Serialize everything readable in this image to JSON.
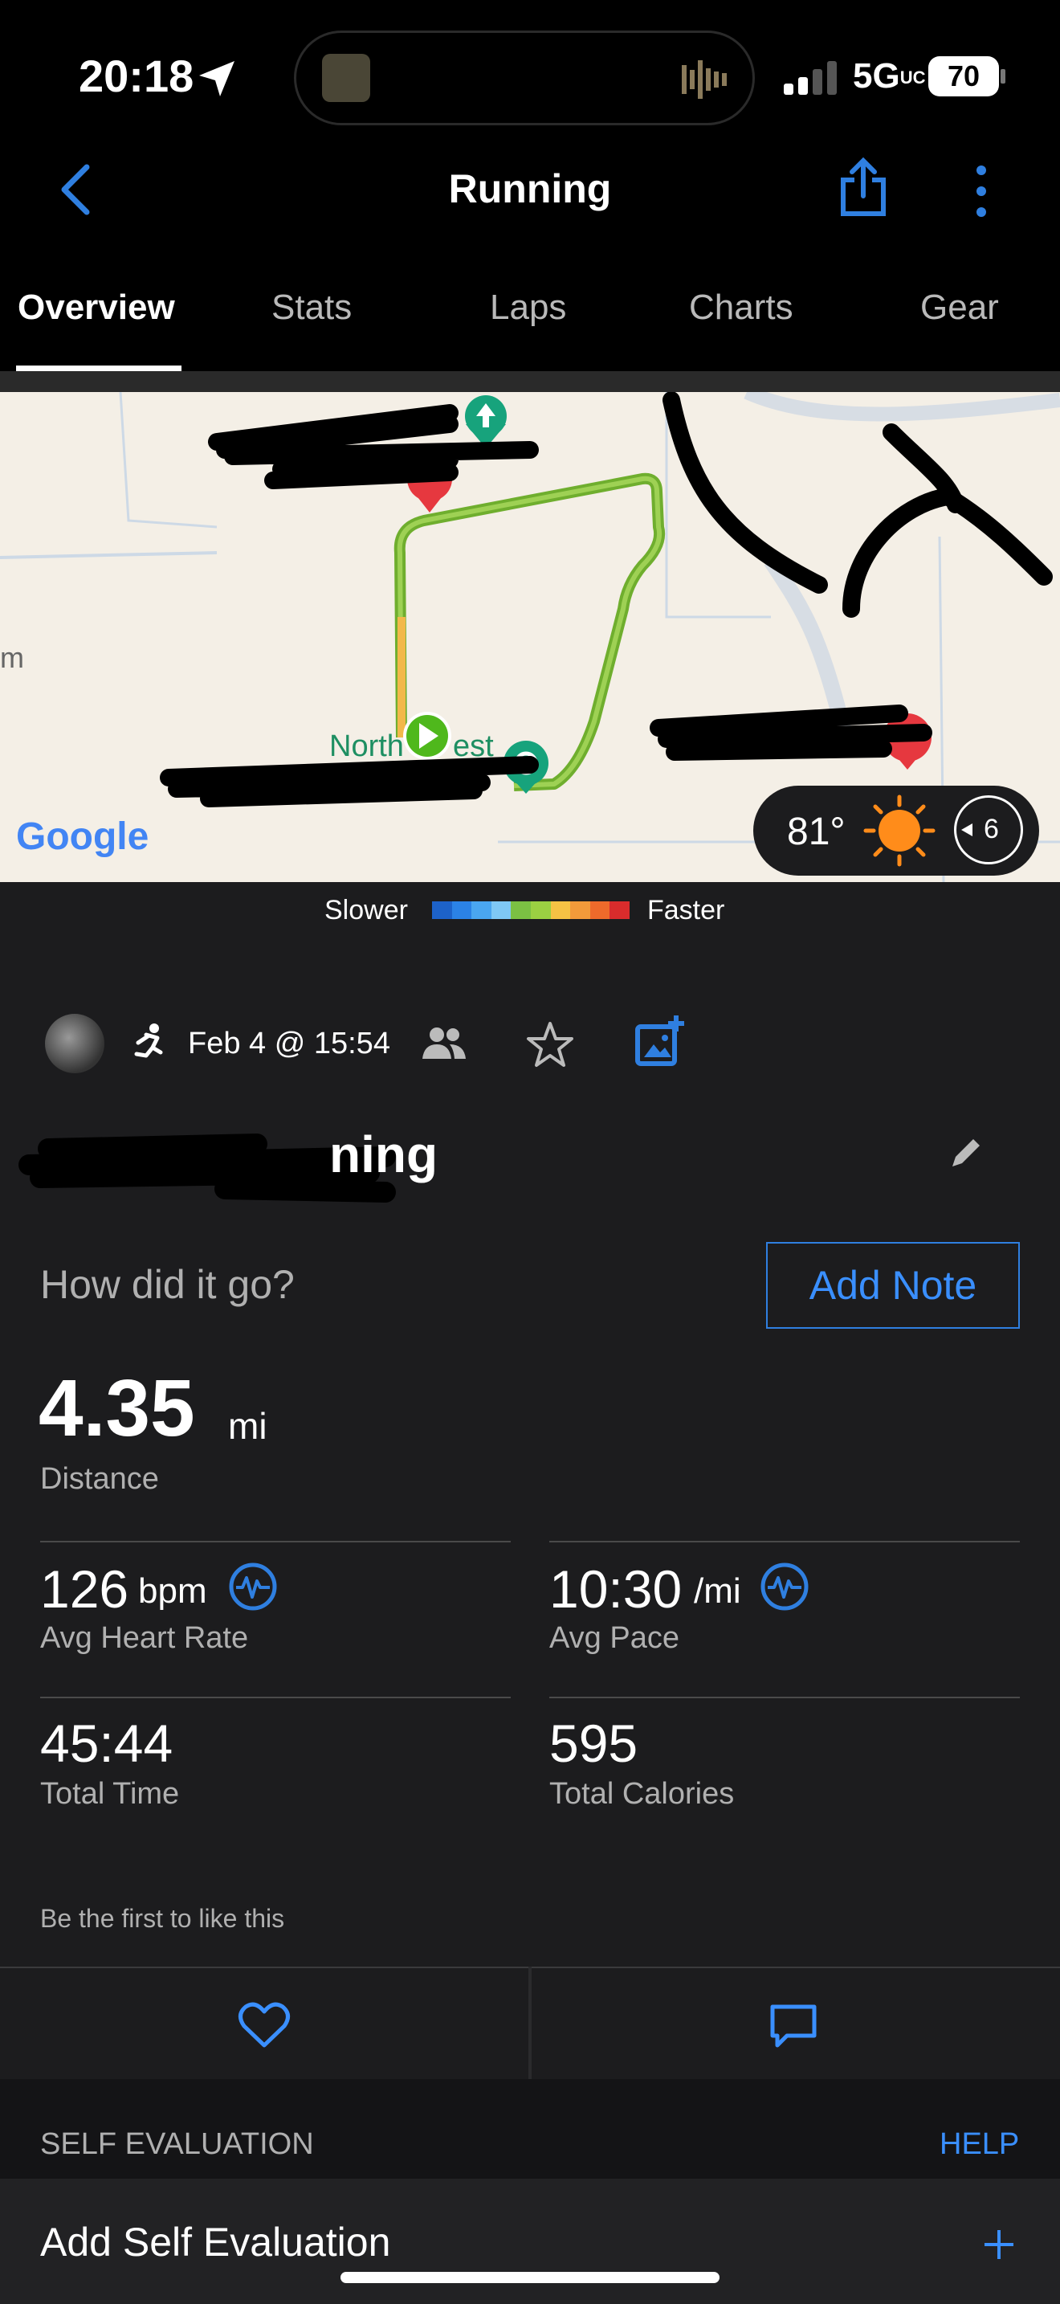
{
  "status": {
    "time": "20:18",
    "network": "5G",
    "network_suffix": "UC",
    "battery": "70"
  },
  "nav": {
    "title": "Running",
    "tabs": [
      "Overview",
      "Stats",
      "Laps",
      "Charts",
      "Gear"
    ],
    "active_tab": "Overview"
  },
  "map": {
    "labels": {
      "north_park": "North",
      "north_park2": "est",
      "left_edge": "m",
      "google": "Google"
    },
    "weather": {
      "temp": "81°",
      "wind": "6"
    },
    "legend": {
      "slower": "Slower",
      "faster": "Faster",
      "colors": [
        "#1d62c9",
        "#2b82e6",
        "#4aa6f0",
        "#7fc8f5",
        "#7bc043",
        "#9bd042",
        "#f6c244",
        "#f39a3a",
        "#ee6a2b",
        "#d92c2c"
      ]
    }
  },
  "activity": {
    "date": "Feb 4 @ 15:54",
    "name_visible": "ning",
    "prompt": "How did it go?",
    "add_note": "Add Note"
  },
  "stats": {
    "distance": {
      "value": "4.35",
      "unit": "mi",
      "label": "Distance"
    },
    "hr": {
      "value": "126",
      "unit": "bpm",
      "label": "Avg Heart Rate"
    },
    "pace": {
      "value": "10:30",
      "unit": "/mi",
      "label": "Avg Pace"
    },
    "time": {
      "value": "45:44",
      "label": "Total Time"
    },
    "calories": {
      "value": "595",
      "label": "Total Calories"
    }
  },
  "social": {
    "likes_text": "Be the first to like this"
  },
  "self_eval": {
    "header": "SELF EVALUATION",
    "help": "HELP",
    "add": "Add Self Evaluation"
  },
  "colors": {
    "accent": "#3a8fff",
    "background": "#1c1c1e"
  }
}
